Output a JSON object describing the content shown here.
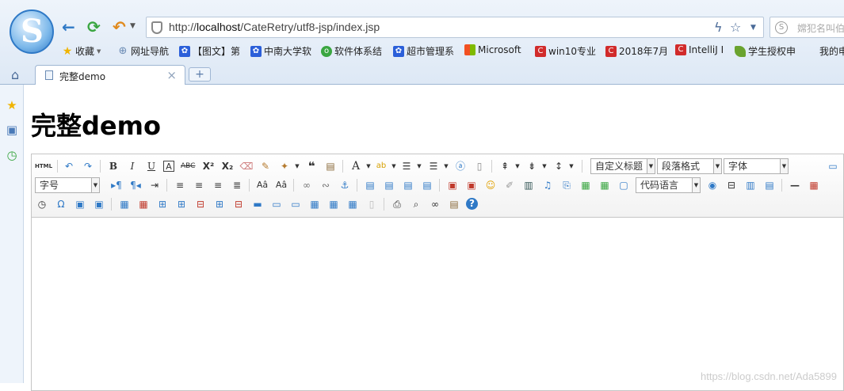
{
  "browser": {
    "url_prefix": "http://",
    "url_host": "localhost",
    "url_path": "/CateRetry/utf8-jsp/index.jsp",
    "search_placeholder": "嫦犯名叫伯",
    "tab_title": "完整demo",
    "new_tab_label": "+",
    "bookmarks": [
      {
        "label": "收藏",
        "icon": "star-icon",
        "color": "#f0b400"
      },
      {
        "label": "网址导航",
        "icon": "globe-icon",
        "color": "#6b8bb4"
      },
      {
        "label": "【图文】第",
        "icon": "baidu-paw-icon",
        "color": "#2b5fd9"
      },
      {
        "label": "中南大学软",
        "icon": "baidu-paw-icon",
        "color": "#2b5fd9"
      },
      {
        "label": "软件体系结",
        "icon": "green-circle-icon",
        "color": "#3aa641"
      },
      {
        "label": "超市管理系",
        "icon": "baidu-paw-icon",
        "color": "#2b5fd9"
      },
      {
        "label": "Microsoft",
        "icon": "windows-logo-icon",
        "color": "#e74c1c"
      },
      {
        "label": "win10专业",
        "icon": "csdn-c-icon",
        "color": "#d12b2b"
      },
      {
        "label": "2018年7月",
        "icon": "csdn-c-icon",
        "color": "#d12b2b"
      },
      {
        "label": "IntelliJ I",
        "icon": "csdn-c-icon",
        "color": "#d12b2b"
      },
      {
        "label": "学生授权申",
        "icon": "jetbrains-icon",
        "color": "#6aa32f"
      },
      {
        "label": "我的申",
        "icon": "none",
        "color": "#222"
      }
    ]
  },
  "page": {
    "heading": "完整demo"
  },
  "editor": {
    "source_label": "HTML",
    "selects": {
      "custom_heading": "自定义标题",
      "paragraph_format": "段落格式",
      "font_family": "字体",
      "font_size": "字号",
      "code_language": "代码语言"
    }
  },
  "watermark": "https://blog.csdn.net/Ada5899"
}
